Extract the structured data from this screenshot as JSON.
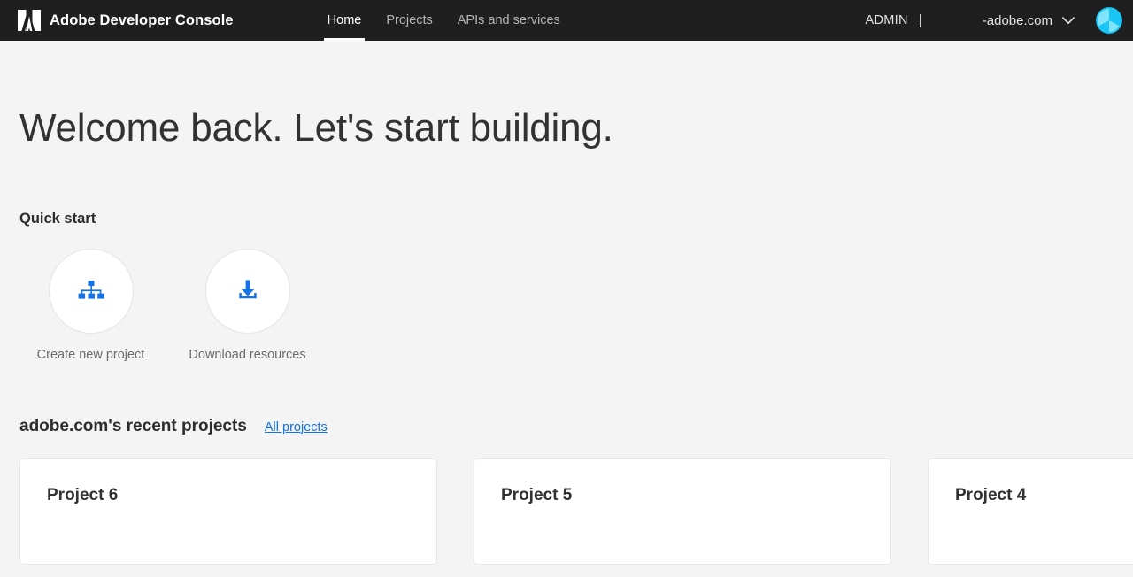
{
  "header": {
    "logo_icon": "adobe-logo-icon",
    "brand_title": "Adobe Developer Console",
    "nav": [
      {
        "label": "Home",
        "active": true
      },
      {
        "label": "Projects",
        "active": false
      },
      {
        "label": "APIs and services",
        "active": false
      }
    ],
    "admin_label": "ADMIN",
    "org_name": "-adobe.com",
    "org_chevron_icon": "chevron-down-icon",
    "avatar_icon": "avatar",
    "colors": {
      "header_bg": "#1f1f1f",
      "nav_active": "#ffffff",
      "nav_inactive": "#b6b6b6",
      "avatar_primary": "#19c5f5",
      "avatar_secondary": "#7fe3fa"
    }
  },
  "main": {
    "welcome_heading": "Welcome back. Let's start building.",
    "quick_start": {
      "title": "Quick start",
      "tiles": [
        {
          "label": "Create new project",
          "icon": "sitemap-icon"
        },
        {
          "label": "Download resources",
          "icon": "download-icon"
        }
      ]
    },
    "recent_projects": {
      "title": "adobe.com's recent projects",
      "all_projects_label": "All projects",
      "cards": [
        {
          "title": "Project 6"
        },
        {
          "title": "Project 5"
        },
        {
          "title": "Project 4"
        }
      ]
    }
  },
  "theme": {
    "page_bg": "#f4f4f4",
    "accent_blue": "#1473e6",
    "card_bg": "#ffffff",
    "card_border": "#e7e7e7"
  }
}
